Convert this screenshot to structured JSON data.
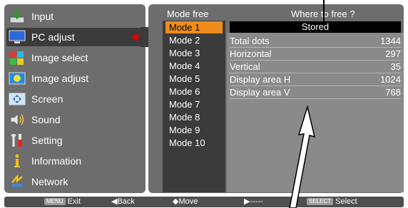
{
  "left_menu": {
    "items": [
      {
        "label": "Input",
        "icon": "input-icon"
      },
      {
        "label": "PC adjust",
        "icon": "pc-adjust-icon",
        "selected": true
      },
      {
        "label": "Image select",
        "icon": "image-select-icon"
      },
      {
        "label": "Image adjust",
        "icon": "image-adjust-icon"
      },
      {
        "label": "Screen",
        "icon": "screen-icon"
      },
      {
        "label": "Sound",
        "icon": "sound-icon"
      },
      {
        "label": "Setting",
        "icon": "setting-icon"
      },
      {
        "label": "Information",
        "icon": "information-icon"
      },
      {
        "label": "Network",
        "icon": "network-icon"
      }
    ]
  },
  "right_panel": {
    "mode_header": "Mode free",
    "where_header": "Where to free ?",
    "modes": [
      "Mode 1",
      "Mode 2",
      "Mode 3",
      "Mode 4",
      "Mode 5",
      "Mode 6",
      "Mode 7",
      "Mode 8",
      "Mode 9",
      "Mode 10"
    ],
    "selected_mode": "Mode 1",
    "stored_label": "Stored",
    "details": [
      {
        "label": "Total dots",
        "value": "1344"
      },
      {
        "label": "Horizontal",
        "value": "297"
      },
      {
        "label": "Vertical",
        "value": "35"
      },
      {
        "label": "Display area H",
        "value": "1024"
      },
      {
        "label": "Display area V",
        "value": "768"
      }
    ]
  },
  "bottom_bar": {
    "menu_badge": "MENU",
    "exit_label": "Exit",
    "back_label": "◀Back",
    "move_label": "◆Move",
    "next_label": "▶-----",
    "select_badge": "SELECT",
    "select_label": "Select"
  },
  "colors": {
    "panel": "#6d6d6d",
    "selected_bg": "#3b3b3b",
    "highlight": "#f08c1e",
    "arrow_red": "#e00000"
  }
}
